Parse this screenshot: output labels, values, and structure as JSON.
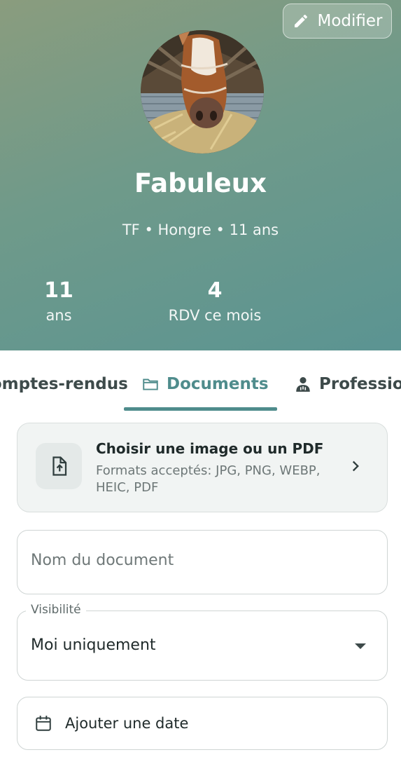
{
  "header": {
    "edit_label": "Modifier",
    "horse_name": "Fabuleux",
    "subtitle": "TF • Hongre • 11 ans"
  },
  "stats": [
    {
      "value": "11",
      "label": "ans"
    },
    {
      "value": "4",
      "label": "RDV ce mois"
    }
  ],
  "tabs": [
    {
      "label": "Comptes-rendus",
      "icon": "report-icon"
    },
    {
      "label": "Documents",
      "icon": "folder-icon",
      "active": true
    },
    {
      "label": "Professionnels",
      "icon": "doctor-icon"
    }
  ],
  "upload": {
    "title": "Choisir une image ou un PDF",
    "formats": "Formats acceptés: JPG, PNG, WEBP, HEIC, PDF"
  },
  "form": {
    "doc_name_placeholder": "Nom du document",
    "visibility_label": "Visibilité",
    "visibility_value": "Moi uniquement",
    "date_label": "Ajouter une date"
  },
  "colors": {
    "accent": "#4f8c8c",
    "hero_start": "#8a9c7e",
    "hero_end": "#5b9492"
  }
}
